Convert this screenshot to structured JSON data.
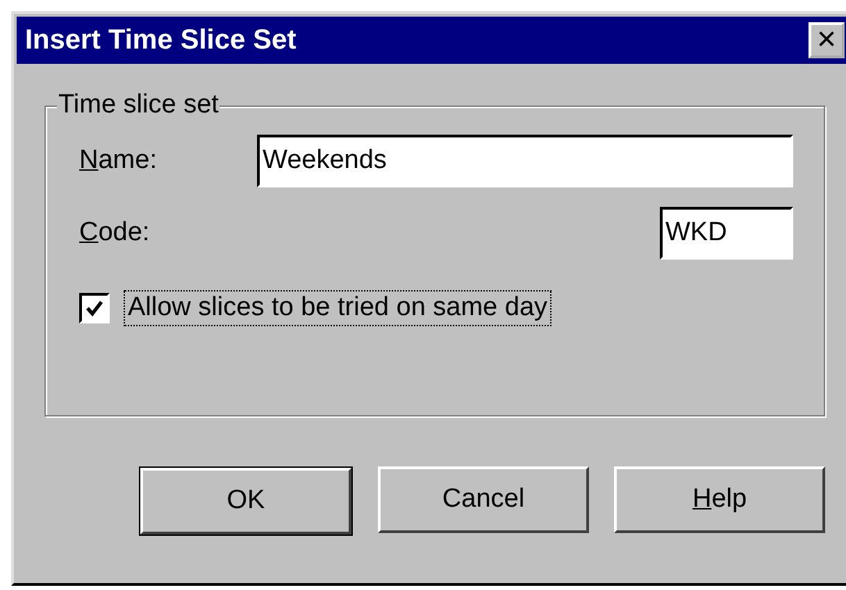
{
  "window": {
    "title": "Insert Time Slice Set",
    "close_glyph": "×"
  },
  "group": {
    "legend": "Time slice set"
  },
  "fields": [
    {
      "label": "Name:",
      "value": "Weekends",
      "underline_first": true,
      "kind": "wide"
    },
    {
      "label": "Code:",
      "value": "WKD",
      "underline_first": true,
      "kind": "short"
    }
  ],
  "checkbox": {
    "label": "Allow slices to be tried on same day",
    "checked": true,
    "focused": true
  },
  "buttons": [
    {
      "label": "OK",
      "default": true,
      "underline_first": false
    },
    {
      "label": "Cancel",
      "default": false,
      "underline_first": false
    },
    {
      "label": "Help",
      "default": false,
      "underline_first": true
    }
  ]
}
